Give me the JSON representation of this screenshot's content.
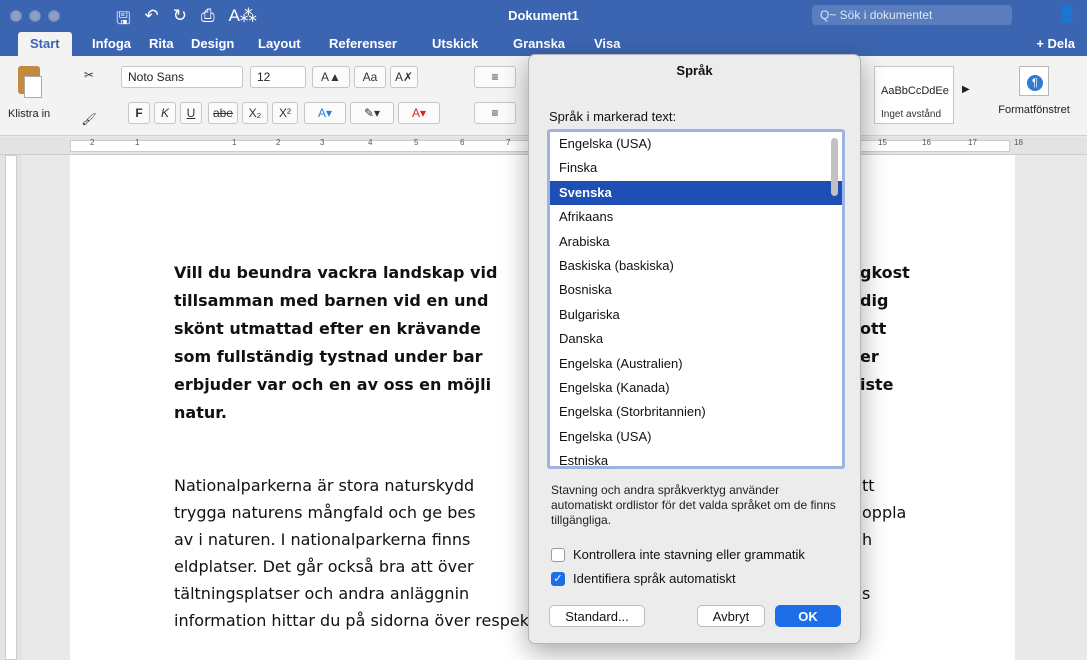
{
  "titlebar": {
    "doc_title": "Dokument1",
    "search_placeholder": "Q~ Sök i dokumentet"
  },
  "tabs": [
    "Start",
    "Infoga",
    "Rita",
    "Design",
    "Layout",
    "Referenser",
    "Utskick",
    "Granska",
    "Visa"
  ],
  "share_label": "+ Dela",
  "ribbon": {
    "paste_label": "Klistra in",
    "font_name": "Noto Sans",
    "font_size": "12",
    "bold": "F",
    "italic": "K",
    "underline": "U",
    "strike": "abe",
    "sub": "X₂",
    "sup": "X²",
    "style_preview": "AaBbCcDdEe",
    "style_name": "Inget avstånd",
    "format_pane": "Formatfönstret"
  },
  "ruler_ticks": [
    "2",
    "1",
    "1",
    "2",
    "3",
    "4",
    "5",
    "6",
    "7",
    "15",
    "16",
    "17",
    "18"
  ],
  "document": {
    "bold_lines": [
      "Vill du beundra vackra landskap vid",
      "tillsamman med barnen vid en und",
      "skönt utmattad efter en krävande",
      "som fullständig tystnad under bar",
      "erbjuder var och en av oss en möjli",
      "natur."
    ],
    "bold_right": [
      "gkost",
      "dig",
      "ott",
      "er",
      "iste"
    ],
    "normal_lines": [
      "Nationalparkerna är stora naturskydd",
      "trygga naturens mångfald och ge bes",
      "av i naturen. I nationalparkerna finns",
      "eldplatser. Det går också bra att över",
      "tältningsplatser och andra anläggnin",
      "information hittar du på sidorna över respektive nationalpark."
    ],
    "normal_right": [
      "tt",
      "oppla",
      "h",
      "s"
    ]
  },
  "dialog": {
    "title": "Språk",
    "list_label": "Språk i markerad text:",
    "languages": [
      "Engelska (USA)",
      "Finska",
      "Svenska",
      "Afrikaans",
      "Arabiska",
      "Baskiska (baskiska)",
      "Bosniska",
      "Bulgariska",
      "Danska",
      "Engelska (Australien)",
      "Engelska (Kanada)",
      "Engelska (Storbritannien)",
      "Engelska (USA)",
      "Estniska"
    ],
    "selected_index": 2,
    "info_text": "Stavning och andra språkverktyg använder automatiskt ordlistor för det valda språket om de finns tillgängliga.",
    "check_no_spell": "Kontrollera inte stavning eller grammatik",
    "check_no_spell_checked": false,
    "check_detect": "Identifiera språk automatiskt",
    "check_detect_checked": true,
    "btn_default": "Standard...",
    "btn_cancel": "Avbryt",
    "btn_ok": "OK"
  }
}
